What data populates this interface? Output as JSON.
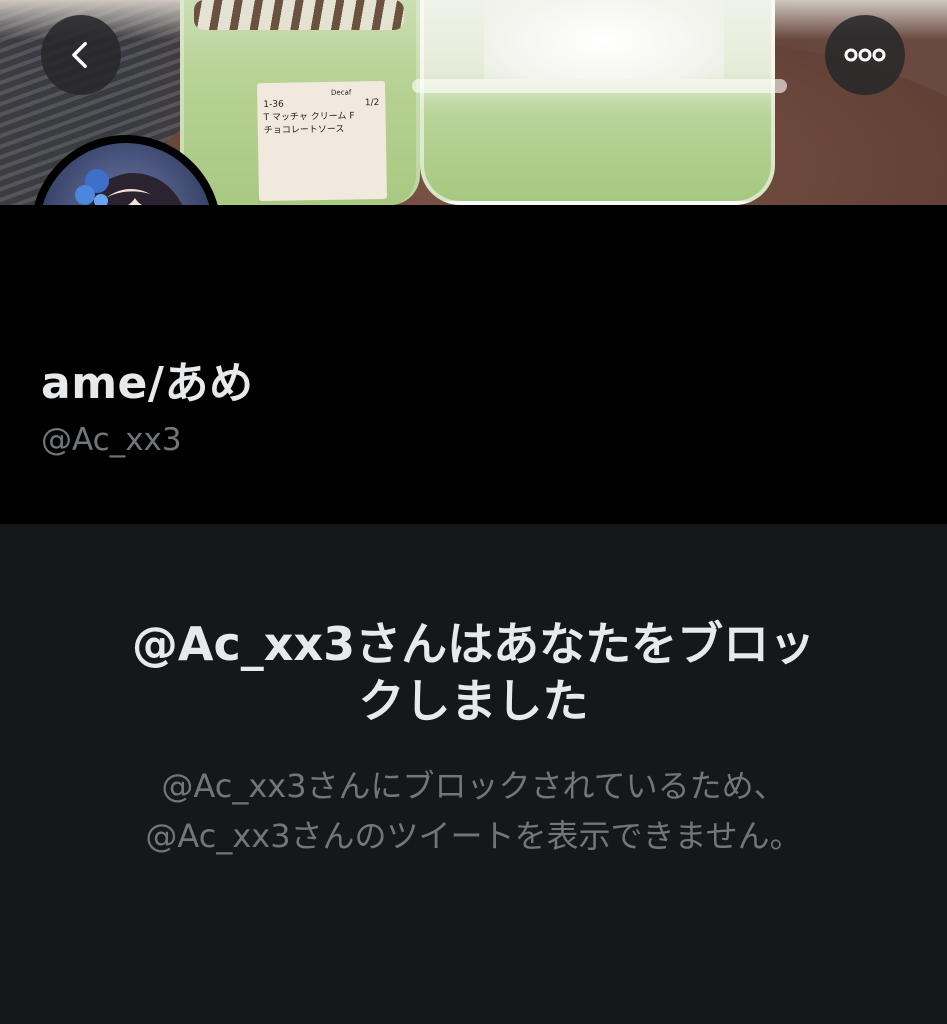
{
  "navigation": {
    "back_icon": "chevron-left-icon",
    "more_icon": "more-horizontal-icon"
  },
  "banner": {
    "receipt_lines": [
      "1-36",
      "1/2",
      "T  マッチャ クリーム F",
      "チョコレートソース"
    ],
    "receipt_header": "Decaf"
  },
  "profile": {
    "display_name": "ame/あめ",
    "handle": "@Ac_xx3"
  },
  "blocked_notice": {
    "title_line1": "@Ac_xx3さんはあなたをブロッ",
    "title_line2": "クしました",
    "description_line1": "@Ac_xx3さんにブロックされているため、",
    "description_line2": "@Ac_xx3さんのツイートを表示できません。"
  },
  "colors": {
    "header_bg": "#000000",
    "body_bg": "#16171a",
    "primary_text": "#e7e9ea",
    "secondary_text": "#71767b"
  }
}
